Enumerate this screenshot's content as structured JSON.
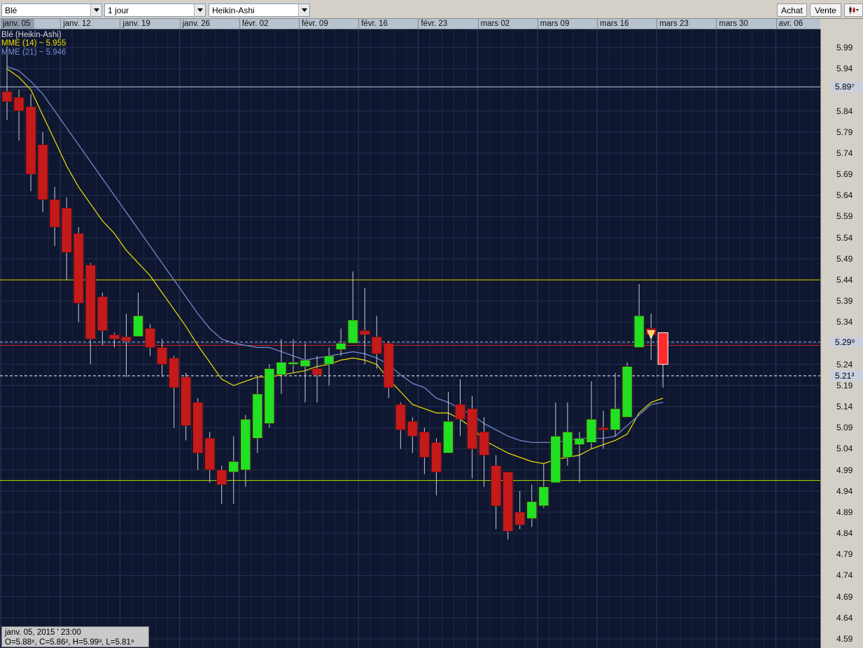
{
  "toolbar": {
    "instrument": "Blé",
    "period": "1 jour",
    "chart_style": "Heikin-Ashi",
    "buy_label": "Achat",
    "sell_label": "Vente",
    "chart_menu_icon": "candlestick-menu-icon"
  },
  "legend": {
    "title": "Blé (Heikin-Ashi)",
    "ema14": "MME (14) ~ 5.955",
    "ema21": "MME (21) ~ 5.946"
  },
  "info": {
    "date": "janv. 05, 2015 ' 23:00",
    "ohlc": "O=5.88⁶, C=5.86², H=5.99³, L=5.81⁹"
  },
  "colors": {
    "background": "#0f1730",
    "up_candle": "#22e022",
    "down_candle": "#c41a1a",
    "last_candle": "#ff2a2a",
    "ema14": "#f0e000",
    "ema21": "#7a8fd8",
    "resistance_line": "#d6d600",
    "support_line": "#b8e000",
    "bid_line": "#d22222"
  },
  "chart_data": {
    "type": "candlestick",
    "title": "Blé (Heikin-Ashi)",
    "date_ticks": [
      "janv. 05",
      "janv. 12",
      "janv. 19",
      "janv. 26",
      "févr. 02",
      "févr. 09",
      "févr. 16",
      "févr. 23",
      "mars 02",
      "mars 09",
      "mars 16",
      "mars 23",
      "mars 30",
      "avr. 06"
    ],
    "price_ticks": [
      "5.99",
      "5.94",
      "5.84",
      "5.79",
      "5.74",
      "5.69",
      "5.64",
      "5.59",
      "5.54",
      "5.49",
      "5.44",
      "5.39",
      "5.34",
      "5.24",
      "5.19",
      "5.14",
      "5.09",
      "5.04",
      "4.99",
      "4.94",
      "4.89",
      "4.84",
      "4.79",
      "4.74",
      "4.69",
      "4.64",
      "4.59"
    ],
    "ylim": [
      4.59,
      5.99
    ],
    "x_start_date": "janv. 05",
    "x_end_date": "avr. 06",
    "candles": [
      {
        "o": 5.886,
        "c": 5.862,
        "h": 5.993,
        "l": 5.819
      },
      {
        "o": 5.872,
        "c": 5.84,
        "h": 5.89,
        "l": 5.77
      },
      {
        "o": 5.85,
        "c": 5.69,
        "h": 5.88,
        "l": 5.65
      },
      {
        "o": 5.76,
        "c": 5.63,
        "h": 5.79,
        "l": 5.6
      },
      {
        "o": 5.63,
        "c": 5.565,
        "h": 5.66,
        "l": 5.52
      },
      {
        "o": 5.61,
        "c": 5.505,
        "h": 5.635,
        "l": 5.44
      },
      {
        "o": 5.55,
        "c": 5.385,
        "h": 5.565,
        "l": 5.34
      },
      {
        "o": 5.475,
        "c": 5.3,
        "h": 5.48,
        "l": 5.24
      },
      {
        "o": 5.4,
        "c": 5.32,
        "h": 5.41,
        "l": 5.285
      },
      {
        "o": 5.31,
        "c": 5.3,
        "h": 5.315,
        "l": 5.28
      },
      {
        "o": 5.305,
        "c": 5.295,
        "h": 5.36,
        "l": 5.21
      },
      {
        "o": 5.306,
        "c": 5.355,
        "h": 5.41,
        "l": 5.306
      },
      {
        "o": 5.325,
        "c": 5.28,
        "h": 5.335,
        "l": 5.26
      },
      {
        "o": 5.28,
        "c": 5.24,
        "h": 5.3,
        "l": 5.21
      },
      {
        "o": 5.255,
        "c": 5.185,
        "h": 5.26,
        "l": 5.09
      },
      {
        "o": 5.21,
        "c": 5.095,
        "h": 5.22,
        "l": 5.06
      },
      {
        "o": 5.15,
        "c": 5.03,
        "h": 5.16,
        "l": 4.99
      },
      {
        "o": 5.065,
        "c": 4.99,
        "h": 5.08,
        "l": 4.96
      },
      {
        "o": 4.99,
        "c": 4.955,
        "h": 5.0,
        "l": 4.91
      },
      {
        "o": 4.985,
        "c": 5.01,
        "h": 5.07,
        "l": 4.91
      },
      {
        "o": 4.99,
        "c": 5.11,
        "h": 5.12,
        "l": 4.95
      },
      {
        "o": 5.065,
        "c": 5.17,
        "h": 5.21,
        "l": 5.03
      },
      {
        "o": 5.1,
        "c": 5.23,
        "h": 5.24,
        "l": 5.09
      },
      {
        "o": 5.215,
        "c": 5.245,
        "h": 5.3,
        "l": 5.17
      },
      {
        "o": 5.24,
        "c": 5.245,
        "h": 5.3,
        "l": 5.22
      },
      {
        "o": 5.235,
        "c": 5.25,
        "h": 5.29,
        "l": 5.15
      },
      {
        "o": 5.23,
        "c": 5.215,
        "h": 5.26,
        "l": 5.15
      },
      {
        "o": 5.24,
        "c": 5.26,
        "h": 5.28,
        "l": 5.19
      },
      {
        "o": 5.275,
        "c": 5.29,
        "h": 5.325,
        "l": 5.26
      },
      {
        "o": 5.29,
        "c": 5.345,
        "h": 5.46,
        "l": 5.29
      },
      {
        "o": 5.32,
        "c": 5.31,
        "h": 5.42,
        "l": 5.24
      },
      {
        "o": 5.305,
        "c": 5.265,
        "h": 5.355,
        "l": 5.23
      },
      {
        "o": 5.29,
        "c": 5.185,
        "h": 5.295,
        "l": 5.16
      },
      {
        "o": 5.145,
        "c": 5.085,
        "h": 5.15,
        "l": 5.04
      },
      {
        "o": 5.105,
        "c": 5.07,
        "h": 5.115,
        "l": 5.03
      },
      {
        "o": 5.08,
        "c": 5.02,
        "h": 5.09,
        "l": 4.98
      },
      {
        "o": 5.055,
        "c": 4.985,
        "h": 5.065,
        "l": 4.93
      },
      {
        "o": 5.03,
        "c": 5.105,
        "h": 5.175,
        "l": 5.03
      },
      {
        "o": 5.145,
        "c": 5.11,
        "h": 5.205,
        "l": 5.07
      },
      {
        "o": 5.135,
        "c": 5.04,
        "h": 5.165,
        "l": 4.97
      },
      {
        "o": 5.08,
        "c": 5.025,
        "h": 5.115,
        "l": 4.95
      },
      {
        "o": 5.0,
        "c": 4.905,
        "h": 5.025,
        "l": 4.85
      },
      {
        "o": 4.985,
        "c": 4.845,
        "h": 4.985,
        "l": 4.825
      },
      {
        "o": 4.89,
        "c": 4.86,
        "h": 4.94,
        "l": 4.85
      },
      {
        "o": 4.875,
        "c": 4.915,
        "h": 4.955,
        "l": 4.855
      },
      {
        "o": 4.905,
        "c": 4.95,
        "h": 5.005,
        "l": 4.9
      },
      {
        "o": 4.96,
        "c": 5.07,
        "h": 5.15,
        "l": 4.96
      },
      {
        "o": 5.02,
        "c": 5.08,
        "h": 5.15,
        "l": 5.0
      },
      {
        "o": 5.05,
        "c": 5.065,
        "h": 5.08,
        "l": 4.96
      },
      {
        "o": 5.055,
        "c": 5.11,
        "h": 5.2,
        "l": 5.04
      },
      {
        "o": 5.09,
        "c": 5.085,
        "h": 5.13,
        "l": 5.04
      },
      {
        "o": 5.085,
        "c": 5.135,
        "h": 5.22,
        "l": 5.07
      },
      {
        "o": 5.115,
        "c": 5.235,
        "h": 5.245,
        "l": 5.115
      },
      {
        "o": 5.28,
        "c": 5.355,
        "h": 5.43,
        "l": 5.28
      },
      {
        "o": 5.325,
        "c": 5.31,
        "h": 5.36,
        "l": 5.25
      },
      {
        "o": 5.315,
        "c": 5.24,
        "h": 5.315,
        "l": 5.185
      }
    ],
    "series": [
      {
        "name": "MME (14)",
        "values": [
          5.94,
          5.92,
          5.89,
          5.83,
          5.77,
          5.71,
          5.66,
          5.62,
          5.58,
          5.55,
          5.51,
          5.48,
          5.45,
          5.41,
          5.37,
          5.33,
          5.285,
          5.245,
          5.205,
          5.19,
          5.2,
          5.21,
          5.21,
          5.215,
          5.22,
          5.225,
          5.235,
          5.24,
          5.25,
          5.255,
          5.25,
          5.24,
          5.205,
          5.175,
          5.145,
          5.135,
          5.125,
          5.125,
          5.11,
          5.09,
          5.06,
          5.045,
          5.03,
          5.02,
          5.01,
          5.005,
          5.015,
          5.02,
          5.025,
          5.04,
          5.05,
          5.06,
          5.075,
          5.125,
          5.15,
          5.16
        ]
      },
      {
        "name": "MME (21)",
        "values": [
          5.945,
          5.935,
          5.91,
          5.88,
          5.84,
          5.8,
          5.76,
          5.72,
          5.68,
          5.64,
          5.6,
          5.56,
          5.52,
          5.48,
          5.44,
          5.4,
          5.36,
          5.325,
          5.3,
          5.29,
          5.285,
          5.28,
          5.28,
          5.27,
          5.26,
          5.25,
          5.255,
          5.26,
          5.265,
          5.27,
          5.265,
          5.255,
          5.24,
          5.215,
          5.195,
          5.185,
          5.16,
          5.15,
          5.135,
          5.12,
          5.1,
          5.085,
          5.07,
          5.06,
          5.055,
          5.055,
          5.055,
          5.06,
          5.065,
          5.065,
          5.065,
          5.07,
          5.095,
          5.12,
          5.145,
          5.15
        ]
      }
    ],
    "horizontal_lines": [
      {
        "value": 5.897,
        "label": "5.89⁷",
        "kind": "line",
        "color": "#c8d0e0"
      },
      {
        "value": 5.44,
        "kind": "line",
        "color": "#d6d600"
      },
      {
        "value": 5.293,
        "kind": "dashed",
        "color": "#a8b8e8"
      },
      {
        "value": 5.285,
        "kind": "line",
        "color": "#d22222"
      },
      {
        "value": 5.213,
        "label": "5.21³",
        "kind": "dashed",
        "color": "#ffffff"
      },
      {
        "value": 4.965,
        "kind": "line",
        "color": "#b8e000"
      }
    ],
    "price_markers": [
      "5.89⁷",
      "5.29⁹",
      "5.21³"
    ],
    "grid": true
  }
}
